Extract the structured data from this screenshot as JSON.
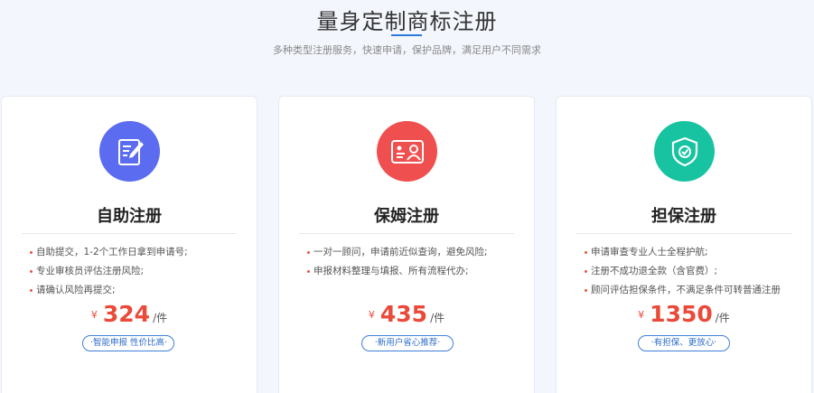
{
  "header": {
    "title": "量身定制商标注册",
    "subtitle": "多种类型注册服务，快速申请，保护品牌，满足用户不同需求"
  },
  "colors": {
    "accent_blue": "#2d7ad6",
    "price_red": "#ea4a3a",
    "icon_blue": "#5b6cf0",
    "icon_red": "#ef4f4f",
    "icon_green": "#17c3a0"
  },
  "cards": [
    {
      "icon": "edit-document-icon",
      "title": "自助注册",
      "features": [
        "自助提交，1-2个工作日拿到申请号;",
        "专业审核员评估注册风险;",
        "请确认风险再提交;"
      ],
      "currency": "¥",
      "price": "324",
      "unit": "/件",
      "tag": "·智能申报 性价比高·"
    },
    {
      "icon": "id-card-person-icon",
      "title": "保姆注册",
      "features": [
        "一对一顾问，申请前近似查询，避免风险;",
        "申报材料整理与填报、所有流程代办;"
      ],
      "currency": "¥",
      "price": "435",
      "unit": "/件",
      "tag": "·新用户省心推荐·"
    },
    {
      "icon": "shield-check-icon",
      "title": "担保注册",
      "features": [
        "申请审查专业人士全程护航;",
        "注册不成功退全款（含官费）;",
        "顾问评估担保条件，不满足条件可转普通注册"
      ],
      "currency": "¥",
      "price": "1350",
      "unit": "/件",
      "tag": "·有担保、更放心·"
    }
  ]
}
